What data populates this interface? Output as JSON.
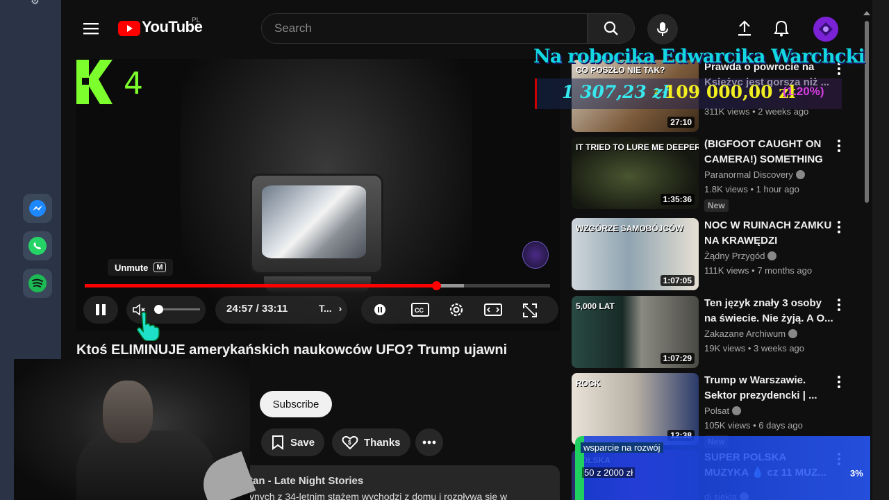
{
  "app": {
    "logo_text": "YouTube",
    "country_code": "PL"
  },
  "search": {
    "placeholder": "Search"
  },
  "player": {
    "channel_logo_text": "4",
    "tooltip_label": "Unmute",
    "tooltip_key": "M",
    "time_display": "24:57 / 33:11",
    "chapter_label": "T...",
    "progress_fraction": 0.755,
    "buffer_fraction": 0.815,
    "volume_fraction": 0.0
  },
  "video": {
    "title": "Ktoś ELIMINUJE amerykańskich naukowców UFO? Trump ujawni",
    "subscribe_label": "Subscribe",
    "save_label": "Save",
    "thanks_label": "Thanks",
    "description_line1": "tan - Late Night Stories",
    "description_line2": "ynych z 34-letnim stażem wychodzi z domu i rozpływa się w"
  },
  "stream_overlay": {
    "title": "Na robocika Edwarcika Warchcki",
    "current_amount": "1 307,23 zł",
    "z_label": "z",
    "target_amount": "109 000,00 zł",
    "percent": "(1.20%)",
    "support_label": "wsparcie na rozwój",
    "support_amount": "50 z 2000 zł",
    "support_percent": "3%"
  },
  "recommendations": [
    {
      "title": "Prawda o powrocie na\nKsiężyc jest gorsza niż ...",
      "channel": "",
      "meta": "311K views • 2 weeks ago",
      "duration": "27:10",
      "thumb_text": "CO POSZŁO NIE TAK?",
      "badge": ""
    },
    {
      "title": "(BIGFOOT CAUGHT ON\nCAMERA!) SOMETHING ...",
      "channel": "Paranormal Discovery",
      "meta": "1.8K views • 1 hour ago",
      "duration": "1:35:36",
      "thumb_text": "IT TRIED TO LURE ME DEEPER!",
      "badge": "New"
    },
    {
      "title": "NOC W RUINACH ZAMKU\nNA KRAWĘDZI URWISKA...",
      "channel": "Żądny Przygód",
      "meta": "111K views • 7 months ago",
      "duration": "1:07:05",
      "thumb_text": "WZGÓRZE SAMOBÓJCÓW",
      "badge": ""
    },
    {
      "title": "Ten język znały 3 osoby\nna świecie. Nie żyją. A O...",
      "channel": "Zakazane Archiwum",
      "meta": "19K views • 3 weeks ago",
      "duration": "1:07:29",
      "thumb_text": "5,000 LAT",
      "badge": ""
    },
    {
      "title": "Trump w Warszawie.\nSektor prezydencki | ...",
      "channel": "Polsat",
      "meta": "105K views • 6 days ago",
      "duration": "12:38",
      "thumb_text": "ROCK",
      "badge": "New"
    },
    {
      "title": "SUPER POLSKA\nMUZYKA 💧 cz 11 MUZ...",
      "channel": "dj siekla",
      "meta": "",
      "duration": "",
      "thumb_text": "POLSKA",
      "badge": ""
    }
  ],
  "colors": {
    "brand_red": "#ff0000",
    "background": "#0f0f0f",
    "accent_cyan": "#12d6e0",
    "accent_yellow": "#f2ef20",
    "accent_magenta": "#d73ee0",
    "k4_green": "#7dff2e"
  },
  "icons": [
    "menu-icon",
    "youtube-logo-icon",
    "search-icon",
    "mic-icon",
    "upload-icon",
    "bell-icon",
    "pause-icon",
    "volume-muted-icon",
    "miniplayer-icon",
    "captions-icon",
    "settings-icon",
    "theater-icon",
    "fullscreen-icon",
    "save-icon",
    "thanks-icon",
    "more-icon",
    "messenger-icon",
    "whatsapp-icon",
    "spotify-icon"
  ]
}
